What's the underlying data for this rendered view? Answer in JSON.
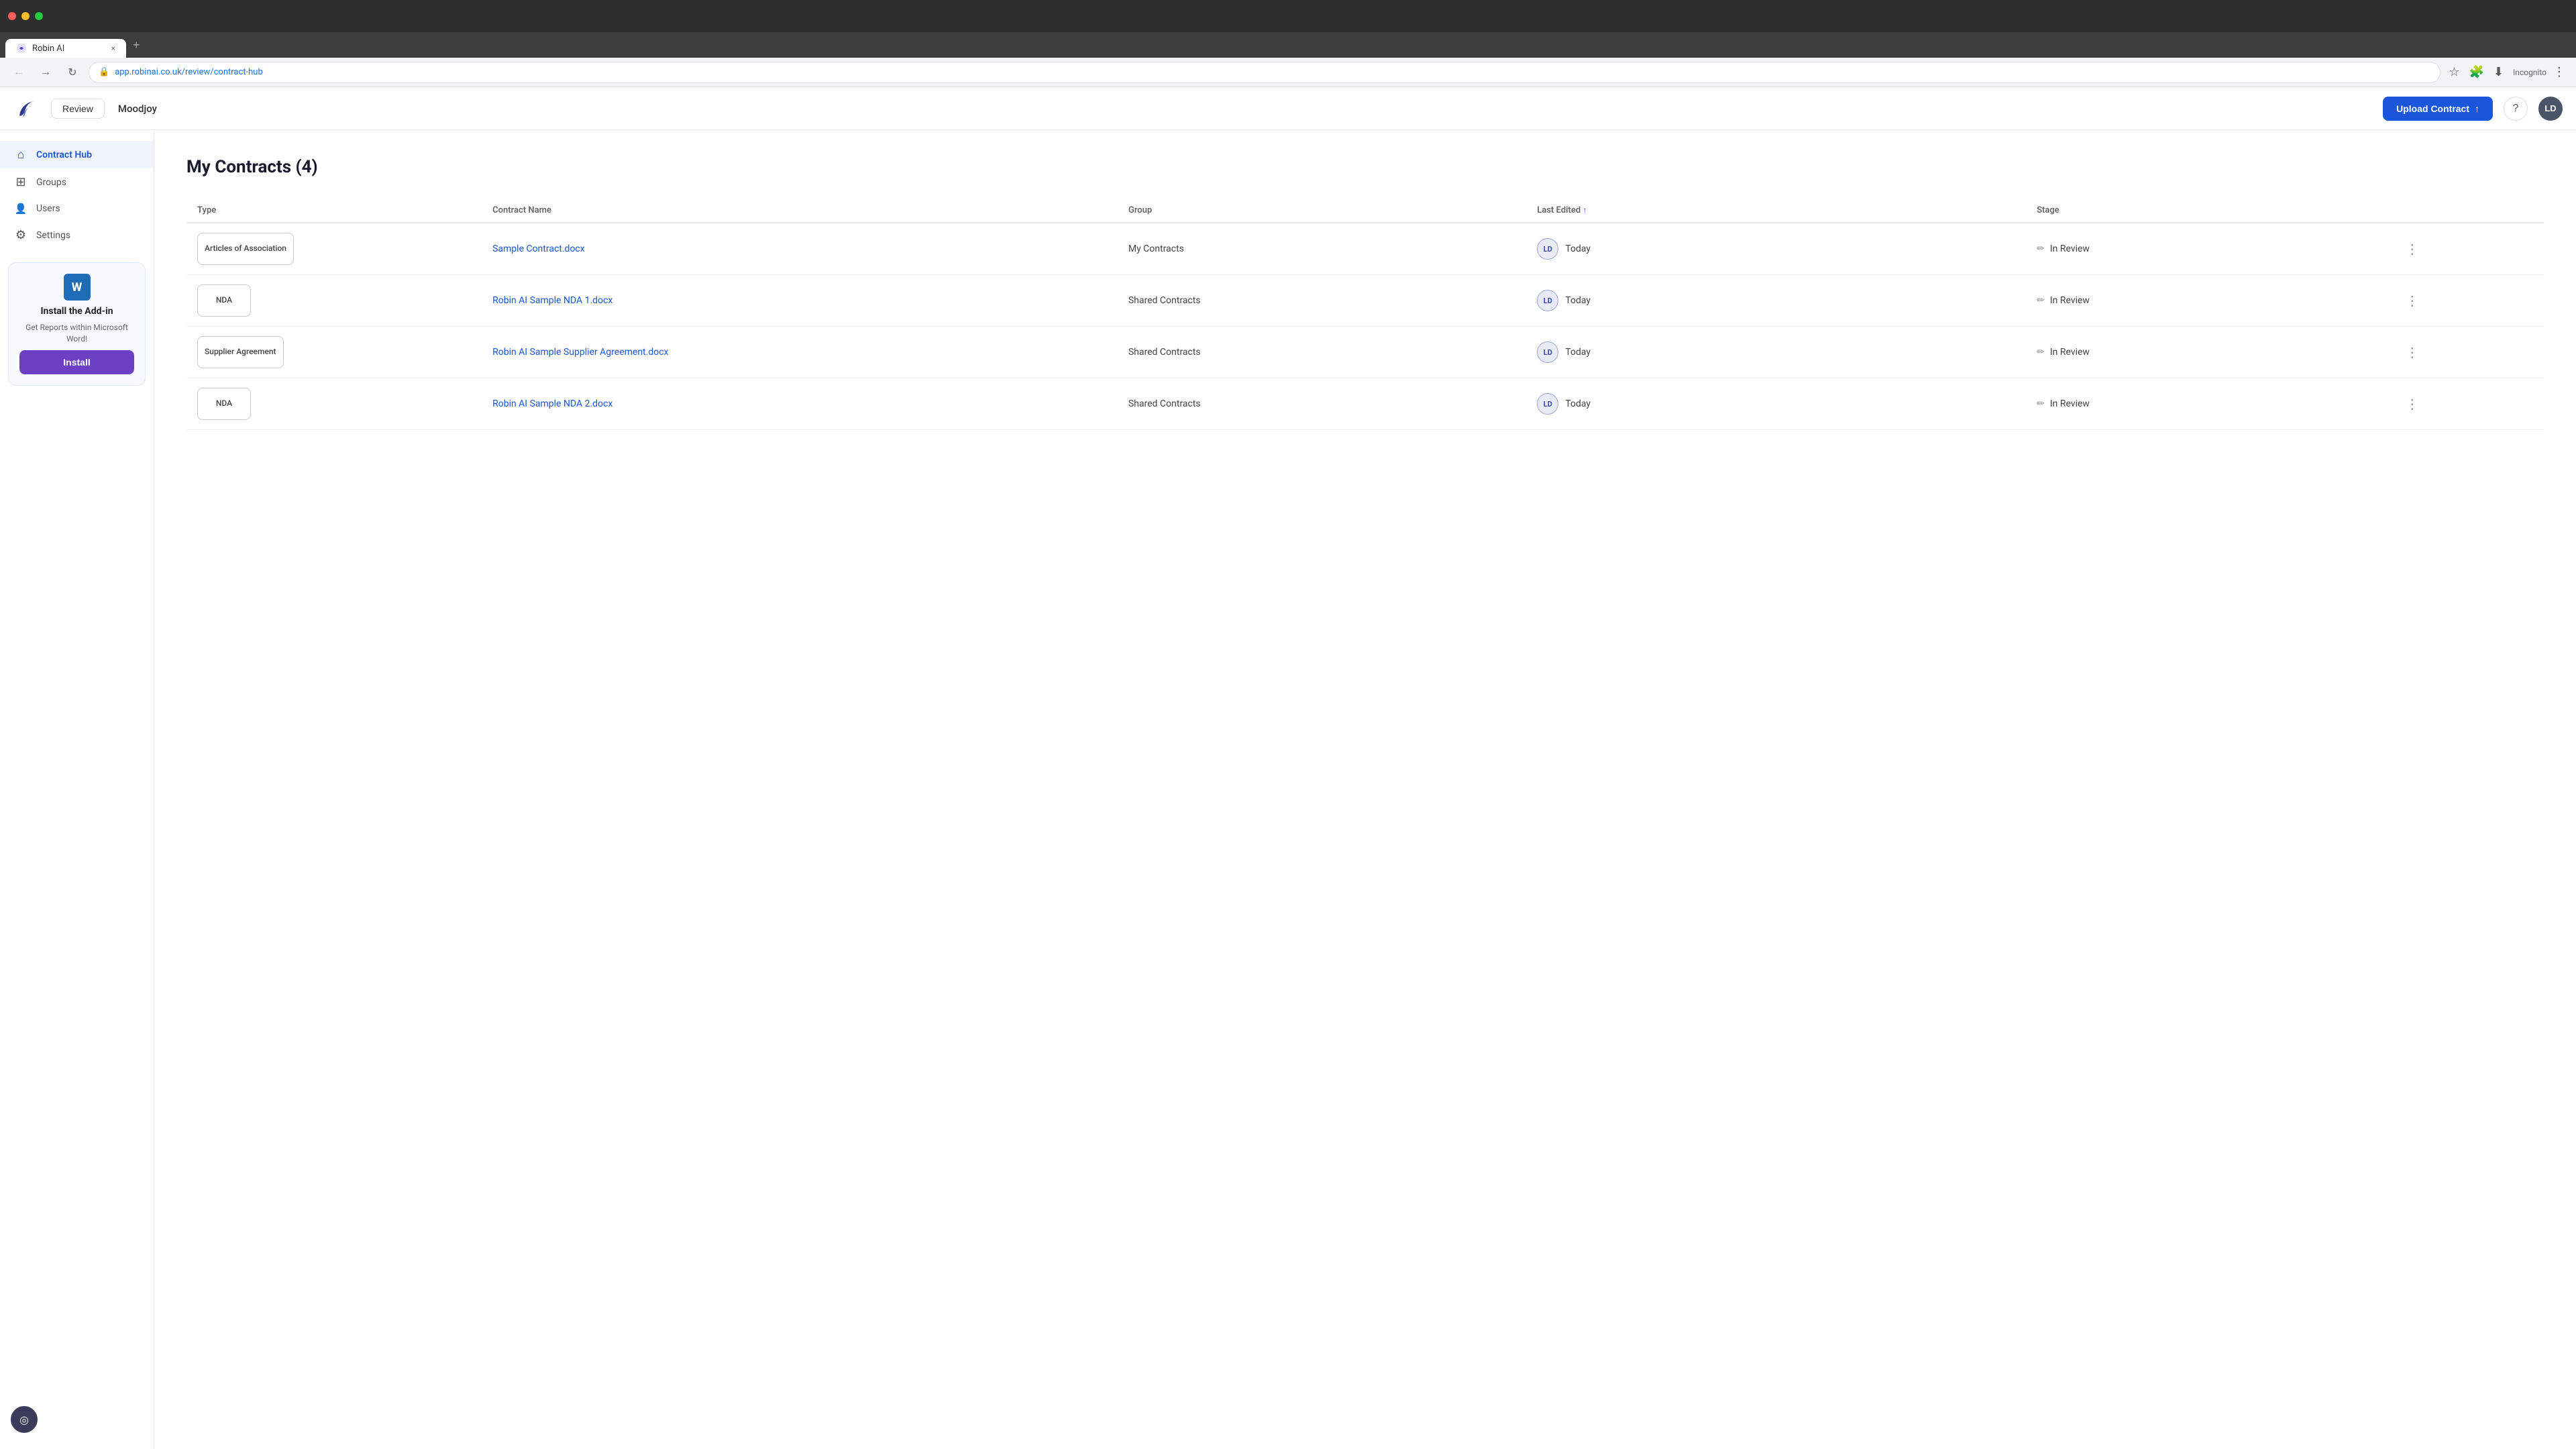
{
  "browser": {
    "tab_label": "Robin AI",
    "tab_close": "×",
    "new_tab": "+",
    "url": "app.robinai.co.uk/review/contract-hub",
    "incognito_label": "Incognito"
  },
  "header": {
    "review_btn": "Review",
    "workspace": "Moodjoy",
    "upload_btn": "Upload Contract",
    "help_icon": "?",
    "avatar": "LD"
  },
  "sidebar": {
    "items": [
      {
        "id": "contract-hub",
        "label": "Contract Hub",
        "icon": "⌂",
        "active": true
      },
      {
        "id": "groups",
        "label": "Groups",
        "icon": "⊞",
        "active": false
      },
      {
        "id": "users",
        "label": "Users",
        "icon": "👤",
        "active": false
      },
      {
        "id": "settings",
        "label": "Settings",
        "icon": "⚙",
        "active": false
      }
    ],
    "addon": {
      "title": "Install the Add-in",
      "description": "Get Reports within Microsoft Word!",
      "install_btn": "Install",
      "word_letter": "W"
    }
  },
  "main": {
    "page_title": "My Contracts (4)",
    "table": {
      "columns": [
        {
          "id": "type",
          "label": "Type",
          "sortable": false
        },
        {
          "id": "name",
          "label": "Contract Name",
          "sortable": false
        },
        {
          "id": "group",
          "label": "Group",
          "sortable": false
        },
        {
          "id": "last_edited",
          "label": "Last Edited",
          "sortable": true,
          "sorted": true
        },
        {
          "id": "stage",
          "label": "Stage",
          "sortable": false
        }
      ],
      "rows": [
        {
          "type": "Articles of Association",
          "contract_name": "Sample Contract.docx",
          "group": "My Contracts",
          "editor_initials": "LD",
          "last_edited": "Today",
          "stage": "In Review"
        },
        {
          "type": "NDA",
          "contract_name": "Robin AI Sample NDA 1.docx",
          "group": "Shared Contracts",
          "editor_initials": "LD",
          "last_edited": "Today",
          "stage": "In Review"
        },
        {
          "type": "Supplier Agreement",
          "contract_name": "Robin AI Sample Supplier Agreement.docx",
          "group": "Shared Contracts",
          "editor_initials": "LD",
          "last_edited": "Today",
          "stage": "In Review"
        },
        {
          "type": "NDA",
          "contract_name": "Robin AI Sample NDA 2.docx",
          "group": "Shared Contracts",
          "editor_initials": "LD",
          "last_edited": "Today",
          "stage": "In Review"
        }
      ]
    }
  },
  "chat_bubble": {
    "icon": "◎"
  }
}
